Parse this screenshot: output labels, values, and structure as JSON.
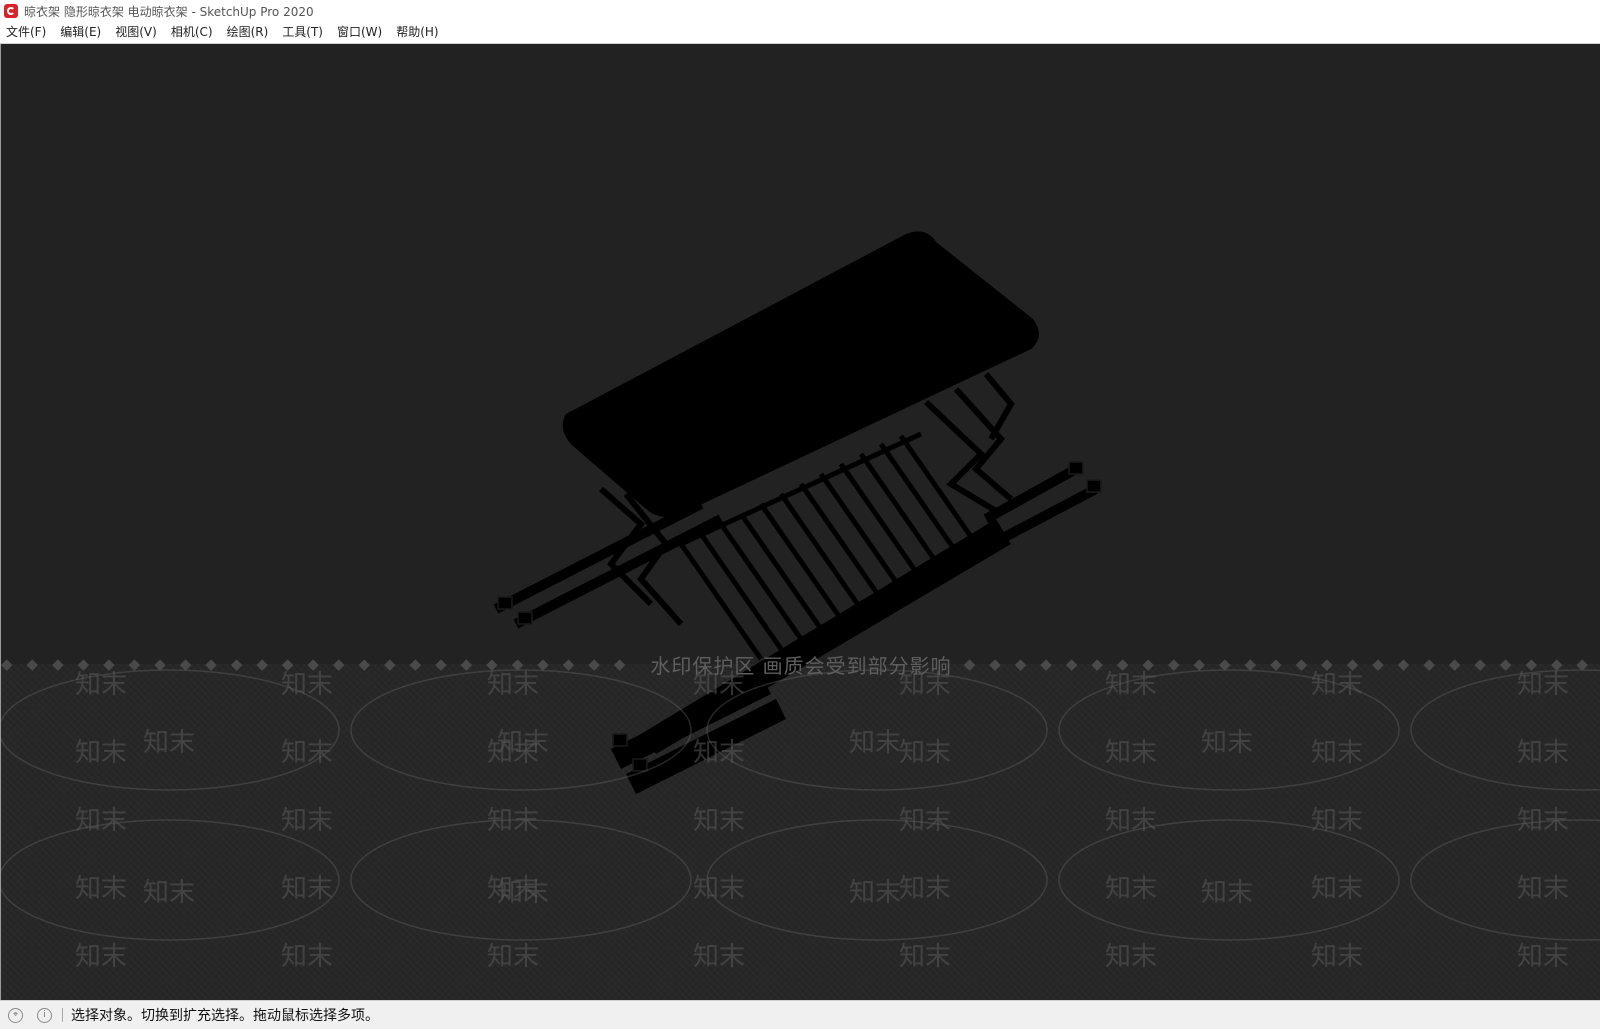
{
  "window": {
    "title": "晾衣架 隐形晾衣架 电动晾衣架 - SketchUp Pro 2020"
  },
  "menu": {
    "items": [
      {
        "label": "文件(F)"
      },
      {
        "label": "编辑(E)"
      },
      {
        "label": "视图(V)"
      },
      {
        "label": "相机(C)"
      },
      {
        "label": "绘图(R)"
      },
      {
        "label": "工具(T)"
      },
      {
        "label": "窗口(W)"
      },
      {
        "label": "帮助(H)"
      }
    ]
  },
  "viewport": {
    "background_color": "#222222",
    "model_color": "#000000",
    "watermark": {
      "banner_text": "水印保护区   画质会受到部分影响",
      "tile_text": "知末",
      "dot_glyph": "◆"
    }
  },
  "statusbar": {
    "icons": [
      "geo-location-icon",
      "info-icon"
    ],
    "message": "选择对象。切换到扩充选择。拖动鼠标选择多项。"
  }
}
